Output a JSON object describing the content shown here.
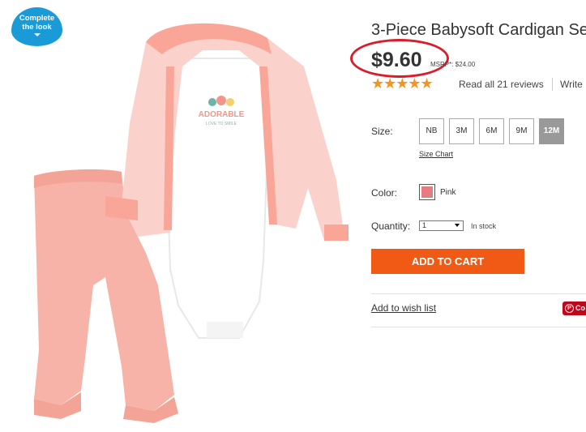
{
  "badge": {
    "line1": "Complete",
    "line2": "the look"
  },
  "product": {
    "title": "3-Piece Babysoft Cardigan Set",
    "price": "$9.60",
    "msrp": "MSRP*: $24.00",
    "stars": "★★★★★",
    "rating": 5,
    "reviews_link": "Read all 21 reviews",
    "write_link": "Write",
    "image_print_text": "ADORABLE",
    "image_print_sub": "LOVE TO SMILE"
  },
  "options": {
    "size_label": "Size:",
    "sizes": [
      "NB",
      "3M",
      "6M",
      "9M",
      "12M"
    ],
    "selected_size": "12M",
    "size_chart": "Size Chart",
    "color_label": "Color:",
    "color_name": "Pink",
    "swatch_color": "#e57c82",
    "quantity_label": "Quantity:",
    "quantity_value": "1",
    "stock_status": "In stock"
  },
  "actions": {
    "add_to_cart": "ADD TO CART",
    "wishlist": "Add to wish list",
    "pinterest": "Co"
  },
  "colors": {
    "cta": "#f05a14",
    "badge": "#1b9ad8",
    "stars": "#f7941d",
    "price_circle": "#d81e2a",
    "pinterest": "#bd081c"
  }
}
